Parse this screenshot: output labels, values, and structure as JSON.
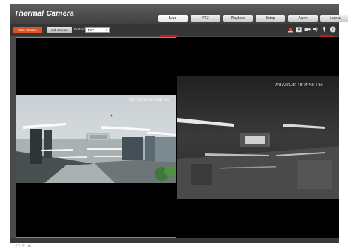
{
  "app": {
    "title": "Thermal Camera"
  },
  "nav": {
    "tabs": [
      {
        "label": "Live",
        "active": true
      },
      {
        "label": "PTZ",
        "active": false
      },
      {
        "label": "Playback",
        "active": false
      },
      {
        "label": "Setup",
        "active": false
      },
      {
        "label": "Alarm",
        "active": false
      },
      {
        "label": "Logout",
        "active": false
      }
    ]
  },
  "toolbar": {
    "main_stream_label": "Main Stream",
    "sub_stream_label": "Sub Stream",
    "protocol_label": "Protocol",
    "protocol_value": "TCP",
    "icons": [
      "alarm-icon",
      "snapshot-icon",
      "record-icon",
      "speaker-icon",
      "microphone-icon",
      "help-icon"
    ]
  },
  "video": {
    "left_timestamp": "2017-03-30 10:21:58 Thu",
    "right_timestamp": "2017-03-30 10:21:58 Thu"
  },
  "status_bar": {
    "icons": [
      "layout-single-icon",
      "layout-quad-icon",
      "fullscreen-icon"
    ]
  },
  "colors": {
    "accent": "#e0531f",
    "active_pane_border": "#4caf50",
    "alert_mark": "#c21d1d"
  }
}
